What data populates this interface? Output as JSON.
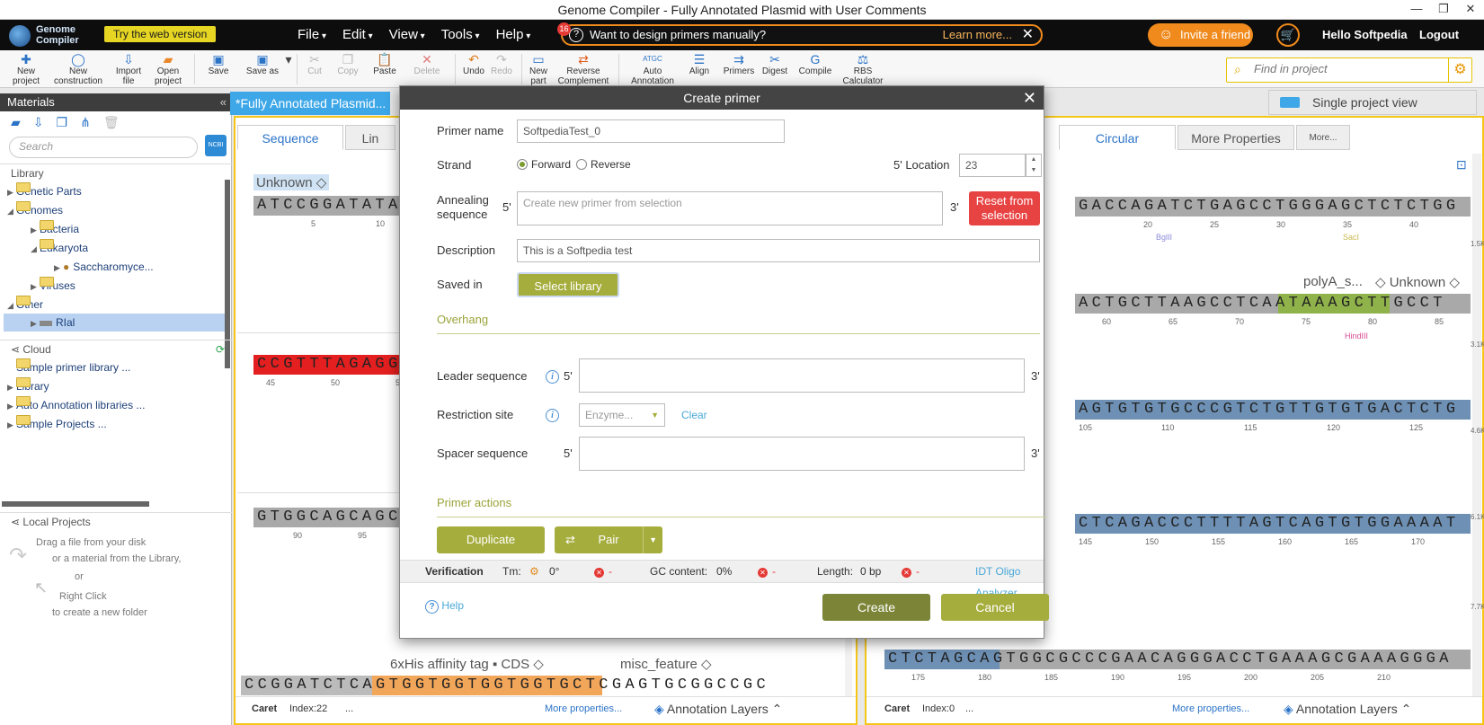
{
  "window": {
    "title": "Genome Compiler - Fully Annotated Plasmid with User Comments",
    "controls": [
      "—",
      "❐",
      "✕"
    ]
  },
  "app": {
    "logo_line1": "Genome",
    "logo_line2": "Compiler",
    "try_web": "Try the web version",
    "menus": [
      "File",
      "Edit",
      "View",
      "Tools",
      "Help"
    ],
    "notif_count": "16",
    "banner_text": "Want to design primers manually?",
    "banner_link": "Learn more...",
    "invite": "Invite a friend",
    "greeting": "Hello Softpedia",
    "logout": "Logout"
  },
  "toolbar": {
    "new_project": [
      "New",
      "project"
    ],
    "new_construction": [
      "New",
      "construction"
    ],
    "import_file": [
      "Import",
      "file"
    ],
    "open_project": [
      "Open",
      "project"
    ],
    "save": "Save",
    "save_as": "Save as",
    "cut": "Cut",
    "copy": "Copy",
    "paste": "Paste",
    "delete": "Delete",
    "undo": "Undo",
    "redo": "Redo",
    "new_part": [
      "New",
      "part"
    ],
    "reverse_complement": [
      "Reverse",
      "Complement"
    ],
    "auto_annotation": [
      "Auto",
      "Annotation"
    ],
    "align": "Align",
    "primers": "Primers",
    "digest": "Digest",
    "compile": "Compile",
    "rbs_calculator": [
      "RBS",
      "Calculator"
    ],
    "find_placeholder": "Find in project"
  },
  "materials": {
    "header": "Materials",
    "search_placeholder": "Search",
    "ncbi": "NCBI",
    "library_section": "Library",
    "tree": [
      {
        "label": "Genetic Parts",
        "indent": 0,
        "open": false
      },
      {
        "label": "Genomes",
        "indent": 0,
        "open": true
      },
      {
        "label": "Bacteria",
        "indent": 1,
        "open": false
      },
      {
        "label": "Eukaryota",
        "indent": 1,
        "open": true
      },
      {
        "label": "Saccharomyce...",
        "indent": 2,
        "open": false
      },
      {
        "label": "Viruses",
        "indent": 1,
        "open": false
      },
      {
        "label": "Other",
        "indent": 0,
        "open": true
      },
      {
        "label": "RIal",
        "indent": 1,
        "open": false,
        "selected": true
      }
    ],
    "cloud_section": "Cloud",
    "cloud": [
      "Sample primer library ...",
      "Library",
      "Auto Annotation libraries ...",
      "Sample Projects ..."
    ],
    "local_section": "Local Projects",
    "local_hint": [
      "Drag a file from your disk",
      "or a material from the Library,",
      "or",
      "Right Click",
      "to create a new folder"
    ]
  },
  "doc_left": {
    "tab_title": "*Fully Annotated Plasmid...",
    "subtabs": [
      "Sequence",
      "Lin"
    ],
    "feat_unknown": "Unknown ◇",
    "rows": [
      {
        "seq": "ATCCGGATATAG",
        "ticks": [
          "5",
          "10"
        ]
      },
      {
        "seq": "CCGTTTAGAGGC",
        "ticks": [
          "45",
          "50",
          "55"
        ]
      },
      {
        "seq": "GTGGCAGCAGCC",
        "ticks": [
          "90",
          "95"
        ]
      }
    ],
    "bottom_seq": "CCGGATCTCAGTGGTGGTGGTGGTGCTCGAGTGCGGCCGC",
    "feat_his": "6xHis affinity tag ▪ CDS ◇",
    "feat_misc": "misc_feature ◇",
    "caret_label": "Caret",
    "caret_index": "Index:22",
    "more_properties": "More properties...",
    "annotation_layers": "Annotation Layers"
  },
  "doc_right": {
    "single_view": "Single project view",
    "subtabs": [
      "Circular",
      "More Properties",
      "More..."
    ],
    "rows": [
      {
        "seq": "GACCAGATCTGAGCCTGGGAGCTCTCTGG",
        "ticks": [
          "20",
          "25",
          "30",
          "35",
          "40"
        ],
        "enzymes": [
          "BglII",
          "SacI"
        ]
      },
      {
        "seq": "ACTGCTTAAGCCTCAATAAAGCTTGCCT",
        "ticks": [
          "60",
          "65",
          "70",
          "75",
          "80",
          "85"
        ],
        "enzymes": [
          "HindIII"
        ]
      },
      {
        "seq": "AGTGTGTGCCCGTCTGTTGTGTGACTCTG",
        "ticks": [
          "105",
          "110",
          "115",
          "120",
          "125"
        ]
      },
      {
        "seq": "CTCAGACCCTTTTAGTCAGTGTGGAAAAT",
        "ticks": [
          "145",
          "150",
          "155",
          "160",
          "165",
          "170"
        ]
      },
      {
        "seq": "CTCTAGCAGTGGCGCCCGAACAGGGACCTGAAAGCGAAAGGGA",
        "ticks": [
          "175",
          "180",
          "185",
          "190",
          "195",
          "200",
          "205",
          "210"
        ]
      }
    ],
    "feat_polya": "polyA_s...",
    "feat_unknown": "◇ Unknown ◇",
    "side_marks": [
      "1.5K",
      "3.1K",
      "4.6K",
      "6.1K",
      "7.7K"
    ],
    "caret_label": "Caret",
    "caret_index": "Index:0",
    "more_properties": "More properties...",
    "annotation_layers": "Annotation Layers"
  },
  "dialog": {
    "title": "Create primer",
    "primer_name_label": "Primer name",
    "primer_name_value": "SoftpediaTest_0",
    "strand_label": "Strand",
    "strand_forward": "Forward",
    "strand_reverse": "Reverse",
    "location_label": "5' Location",
    "location_value": "23",
    "annealing_label": [
      "Annealing",
      "sequence"
    ],
    "five_prime": "5'",
    "three_prime": "3'",
    "annealing_placeholder": "Create new primer from selection",
    "reset_button": [
      "Reset from",
      "selection"
    ],
    "description_label": "Description",
    "description_value": "This is a Softpedia test",
    "saved_in_label": "Saved in",
    "select_library": "Select library",
    "overhang_title": "Overhang",
    "leader_label": "Leader sequence",
    "restriction_label": "Restriction site",
    "enzyme_placeholder": "Enzyme...",
    "clear": "Clear",
    "spacer_label": "Spacer sequence",
    "primer_actions_title": "Primer actions",
    "duplicate": "Duplicate",
    "pair": "Pair",
    "verification": {
      "label": "Verification",
      "tm_label": "Tm:",
      "tm_value": "0°",
      "gc_label": "GC content:",
      "gc_value": "0%",
      "length_label": "Length:",
      "length_value": "0 bp",
      "dash": "-",
      "analyzer": "IDT Oligo Analyzer"
    },
    "help": "Help",
    "create": "Create",
    "cancel": "Cancel"
  },
  "colors": {
    "accent_orange": "#f08a1c",
    "olive": "#a5ad3c",
    "doc_border": "#f5c518",
    "tab_blue": "#3ea7e8",
    "reset_red": "#e84343"
  }
}
